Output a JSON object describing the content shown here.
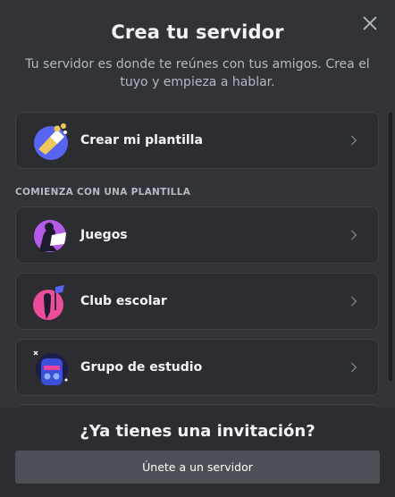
{
  "modal": {
    "title": "Crea tu servidor",
    "subtitle": "Tu servidor es donde te reúnes con tus amigos. Crea el tuyo y empieza a hablar.",
    "close_icon": "close-icon"
  },
  "create_option": {
    "label": "Crear mi plantilla",
    "icon": "create-template-icon"
  },
  "templates": {
    "header": "COMIENZA CON UNA PLANTILLA",
    "items": [
      {
        "label": "Juegos",
        "icon": "gaming-icon"
      },
      {
        "label": "Club escolar",
        "icon": "school-club-icon"
      },
      {
        "label": "Grupo de estudio",
        "icon": "study-group-icon"
      }
    ]
  },
  "footer": {
    "title": "¿Ya tienes una invitación?",
    "join_button": "Únete a un servidor"
  },
  "colors": {
    "background": "#313338",
    "card": "#2b2d31",
    "card_border": "#3f4147",
    "text_primary": "#f2f3f5",
    "text_muted": "#b5bac1",
    "button": "#4e5058"
  }
}
